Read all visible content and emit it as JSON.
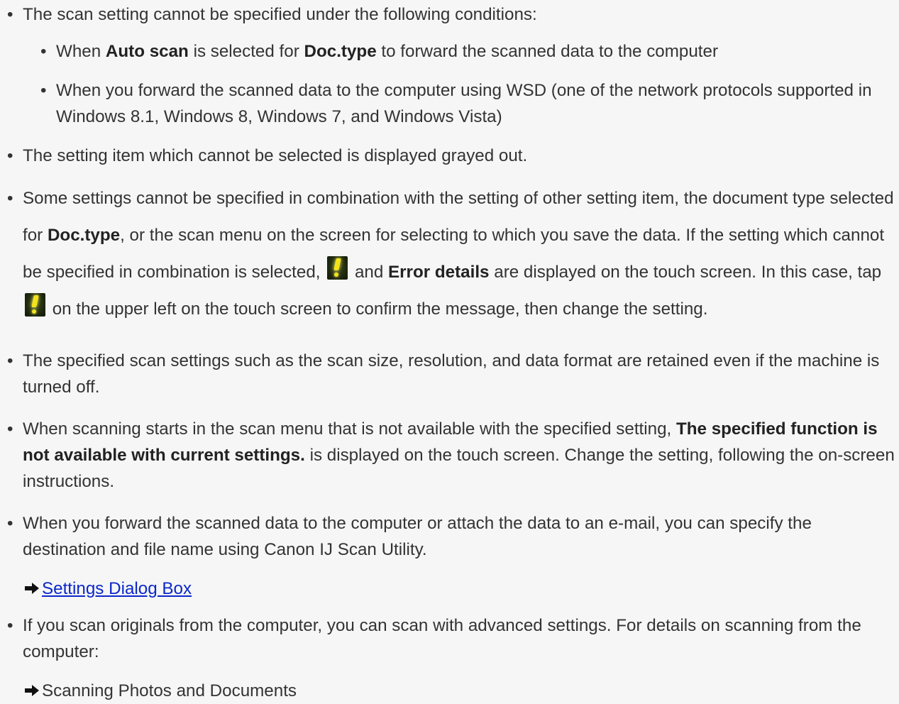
{
  "bullet_char": "•",
  "items": [
    {
      "id": "conditions",
      "text": "The scan setting cannot be specified under the following conditions:"
    },
    {
      "id": "auto-scan",
      "t1": "When ",
      "b1": "Auto scan",
      "t2": " is selected for ",
      "b2": "Doc.type",
      "t3": " to forward the scanned data to the computer"
    },
    {
      "id": "wsd",
      "text": "When you forward the scanned data to the computer using WSD (one of the network protocols supported in Windows 8.1, Windows 8, Windows 7, and Windows Vista)"
    },
    {
      "id": "grayed",
      "text": "The setting item which cannot be selected is displayed grayed out."
    },
    {
      "id": "combination",
      "t1": "Some settings cannot be specified in combination with the setting of other setting item, the document type selected for ",
      "b1": "Doc.type",
      "t2": ", or the scan menu on the screen for selecting to which you save the data. If the setting which cannot be specified in combination is selected, ",
      "t3": " and ",
      "b2": "Error details",
      "t4": " are displayed on the touch screen. In this case, tap ",
      "t5": " on the upper left on the touch screen to confirm the message, then change the setting."
    },
    {
      "id": "retained",
      "text": "The specified scan settings such as the scan size, resolution, and data format are retained even if the machine is turned off."
    },
    {
      "id": "not-available",
      "t1": "When scanning starts in the scan menu that is not available with the specified setting, ",
      "b1": "The specified function is not available with current settings.",
      "t2": " is displayed on the touch screen. Change the setting, following the on-screen instructions."
    },
    {
      "id": "forward",
      "text": "When you forward the scanned data to the computer or attach the data to an e-mail, you can specify the destination and file name using Canon IJ Scan Utility."
    },
    {
      "id": "advanced",
      "text": "If you scan originals from the computer, you can scan with advanced settings. For details on scanning from the computer:"
    }
  ],
  "links": {
    "settings_dialog": "Settings Dialog Box",
    "scanning_photos": "Scanning Photos and Documents"
  },
  "icons": {
    "warning": "warning-exclamation-icon",
    "arrow": "right-arrow-icon"
  },
  "colors": {
    "link": "#0b27cc",
    "text": "#333333",
    "background": "#f5f6f5",
    "icon_yellow": "#f4e21a"
  }
}
